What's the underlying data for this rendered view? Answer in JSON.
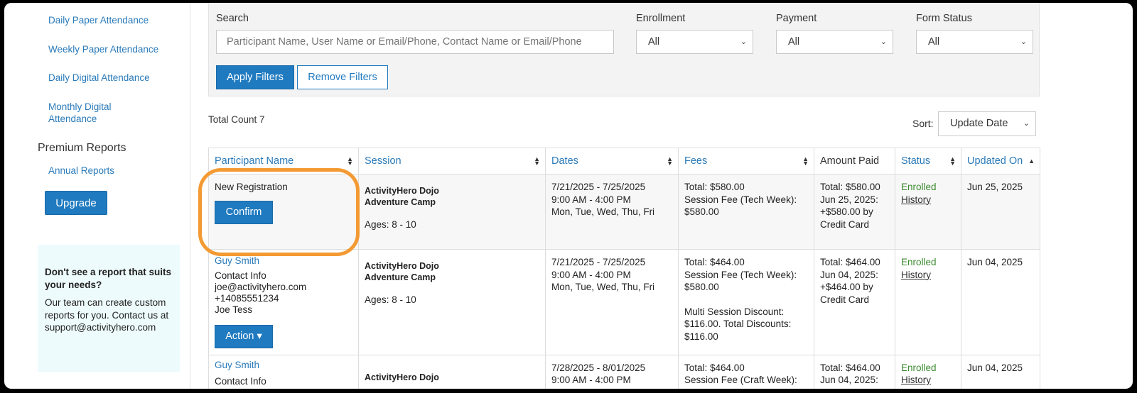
{
  "sidebar": {
    "links": [
      {
        "label": "Daily Paper Attendance"
      },
      {
        "label": "Weekly Paper Attendance"
      },
      {
        "label": "Daily Digital Attendance"
      },
      {
        "label": "Monthly Digital Attendance"
      }
    ],
    "premium_heading": "Premium Reports",
    "annual_reports": "Annual Reports",
    "upgrade": "Upgrade",
    "help_title": "Don't see a report that suits your needs?",
    "help_text": "Our team can create custom reports for you. Contact us at support@activityhero.com"
  },
  "filters": {
    "search_label": "Search",
    "search_placeholder": "Participant Name, User Name or Email/Phone, Contact Name or Email/Phone",
    "enrollment_label": "Enrollment",
    "enrollment_value": "All",
    "payment_label": "Payment",
    "payment_value": "All",
    "form_status_label": "Form Status",
    "form_status_value": "All",
    "apply": "Apply Filters",
    "remove": "Remove Filters"
  },
  "total_count": "Total Count 7",
  "sort": {
    "label": "Sort:",
    "value": "Update Date"
  },
  "table": {
    "headers": [
      "Participant Name",
      "Session",
      "Dates",
      "Fees",
      "Amount Paid",
      "Status",
      "Updated On"
    ],
    "rows": [
      {
        "participant": {
          "status_text": "New Registration",
          "button": "Confirm"
        },
        "session": [
          "ActivityHero Dojo",
          "Adventure Camp"
        ],
        "ages": "Ages: 8 - 10",
        "dates": [
          "7/21/2025 - 7/25/2025",
          "9:00 AM - 4:00 PM",
          "Mon, Tue, Wed, Thu, Fri"
        ],
        "fees": [
          "Total: $580.00",
          "Session Fee (Tech Week):",
          "$580.00"
        ],
        "paid": [
          "Total: $580.00",
          "Jun 25, 2025:",
          "+$580.00 by",
          "Credit Card"
        ],
        "status": "Enrolled",
        "history": "History",
        "updated": "Jun 25, 2025"
      },
      {
        "participant": {
          "name": "Guy Smith",
          "contact": [
            "Contact Info",
            "joe@activityhero.com",
            "+14085551234",
            "Joe Tess"
          ],
          "button": "Action"
        },
        "session": [
          "ActivityHero Dojo",
          "Adventure Camp"
        ],
        "ages": "Ages: 8 - 10",
        "dates": [
          "7/21/2025 - 7/25/2025",
          "9:00 AM - 4:00 PM",
          "Mon, Tue, Wed, Thu, Fri"
        ],
        "fees": [
          "Total: $464.00",
          "Session Fee (Tech Week):",
          "$580.00"
        ],
        "fees_discount": [
          "Multi Session Discount:",
          "$116.00. Total Discounts:",
          "$116.00"
        ],
        "paid": [
          "Total: $464.00",
          "Jun 04, 2025:",
          "+$464.00 by",
          "Credit Card"
        ],
        "status": "Enrolled",
        "history": "History",
        "updated": "Jun 04, 2025"
      },
      {
        "participant": {
          "name": "Guy Smith",
          "contact": [
            "Contact Info"
          ]
        },
        "session": [
          "ActivityHero Dojo"
        ],
        "dates": [
          "7/28/2025 - 8/01/2025",
          "9:00 AM - 4:00 PM"
        ],
        "fees": [
          "Total: $464.00",
          "Session Fee (Craft Week):"
        ],
        "paid": [
          "Total: $464.00",
          "Jun 04, 2025:"
        ],
        "status": "Enrolled",
        "history": "History",
        "updated": "Jun 04, 2025"
      }
    ]
  },
  "colors": {
    "accent": "#1f7ac0",
    "highlight": "#f39a33",
    "enrolled": "#3a8a2e"
  }
}
